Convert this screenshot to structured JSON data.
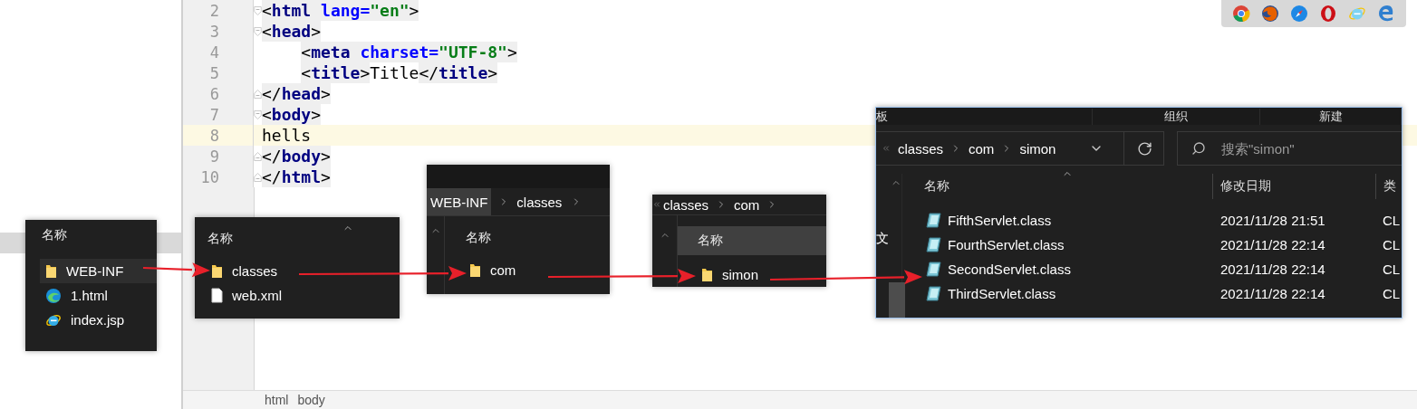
{
  "editor": {
    "lines": [
      {
        "number": "2",
        "kind": "fold-start",
        "indented": false,
        "current": false,
        "tokens": [
          {
            "kind": "punct",
            "text": "<"
          },
          {
            "kind": "tag",
            "text": "html"
          },
          {
            "kind": "attr",
            "text": " lang="
          },
          {
            "kind": "string",
            "text": "\"en\""
          },
          {
            "kind": "punct",
            "text": ">"
          }
        ]
      },
      {
        "number": "3",
        "kind": "fold-start",
        "indented": false,
        "current": false,
        "tokens": [
          {
            "kind": "punct",
            "text": "<"
          },
          {
            "kind": "tag",
            "text": "head"
          },
          {
            "kind": "punct",
            "text": ">"
          }
        ]
      },
      {
        "number": "4",
        "kind": "plain",
        "indented": true,
        "current": false,
        "tokens": [
          {
            "kind": "punct",
            "text": "<"
          },
          {
            "kind": "tag",
            "text": "meta"
          },
          {
            "kind": "attr",
            "text": " charset="
          },
          {
            "kind": "string",
            "text": "\"UTF-8\""
          },
          {
            "kind": "punct",
            "text": ">"
          }
        ]
      },
      {
        "number": "5",
        "kind": "plain",
        "indented": true,
        "current": false,
        "tokens": [
          {
            "kind": "punct",
            "text": "<"
          },
          {
            "kind": "tag",
            "text": "title"
          },
          {
            "kind": "punct",
            "text": ">"
          },
          {
            "kind": "text",
            "text": "Title"
          },
          {
            "kind": "punct",
            "text": "</"
          },
          {
            "kind": "tag",
            "text": "title"
          },
          {
            "kind": "punct",
            "text": ">"
          }
        ]
      },
      {
        "number": "6",
        "kind": "fold-end",
        "indented": false,
        "current": false,
        "tokens": [
          {
            "kind": "punct",
            "text": "</"
          },
          {
            "kind": "tag",
            "text": "head"
          },
          {
            "kind": "punct",
            "text": ">"
          }
        ]
      },
      {
        "number": "7",
        "kind": "fold-start",
        "indented": false,
        "current": false,
        "tokens": [
          {
            "kind": "punct",
            "text": "<"
          },
          {
            "kind": "tag",
            "text": "body"
          },
          {
            "kind": "punct",
            "text": ">"
          }
        ]
      },
      {
        "number": "8",
        "kind": "plain",
        "indented": false,
        "current": true,
        "tokens": [
          {
            "kind": "text",
            "text": "hells"
          }
        ]
      },
      {
        "number": "9",
        "kind": "fold-end",
        "indented": false,
        "current": false,
        "tokens": [
          {
            "kind": "punct",
            "text": "</"
          },
          {
            "kind": "tag",
            "text": "body"
          },
          {
            "kind": "punct",
            "text": ">"
          }
        ]
      },
      {
        "number": "10",
        "kind": "fold-end",
        "indented": false,
        "current": false,
        "tokens": [
          {
            "kind": "punct",
            "text": "</"
          },
          {
            "kind": "tag",
            "text": "html"
          },
          {
            "kind": "punct",
            "text": ">"
          }
        ]
      }
    ],
    "breadcrumb": [
      "html",
      "body"
    ]
  },
  "root_listing": {
    "header": "名称",
    "items": [
      {
        "name": "WEB-INF",
        "kind": "folder",
        "selected": true
      },
      {
        "name": "1.html",
        "kind": "edge",
        "selected": false
      },
      {
        "name": "index.jsp",
        "kind": "ie",
        "selected": false
      }
    ]
  },
  "web_inf_listing": {
    "header": "名称",
    "items": [
      {
        "name": "classes",
        "kind": "folder"
      },
      {
        "name": "web.xml",
        "kind": "file"
      }
    ]
  },
  "classes_listing": {
    "path": [
      {
        "label": "WEB-INF",
        "selected": true
      },
      {
        "label": "classes",
        "selected": false
      }
    ],
    "header": "名称",
    "items": [
      {
        "name": "com",
        "kind": "folder"
      }
    ]
  },
  "com_listing": {
    "path": [
      "classes",
      "com"
    ],
    "header": "名称",
    "items": [
      {
        "name": "simon",
        "kind": "folder"
      }
    ]
  },
  "simon_window": {
    "ribbon": [
      "板",
      "组织",
      "新建"
    ],
    "path": [
      "classes",
      "com",
      "simon"
    ],
    "search": {
      "placeholder": "搜索\"simon\""
    },
    "nav_text": "文",
    "columns": [
      "名称",
      "修改日期",
      "类"
    ],
    "rows": [
      {
        "name": "FifthServlet.class",
        "modified": "2021/11/28 21:51",
        "type": "CL",
        "kind": "class"
      },
      {
        "name": "FourthServlet.class",
        "modified": "2021/11/28 22:14",
        "type": "CL",
        "kind": "class"
      },
      {
        "name": "SecondServlet.class",
        "modified": "2021/11/28 22:14",
        "type": "CL",
        "kind": "class"
      },
      {
        "name": "ThirdServlet.class",
        "modified": "2021/11/28 22:14",
        "type": "CL",
        "kind": "class"
      }
    ]
  }
}
